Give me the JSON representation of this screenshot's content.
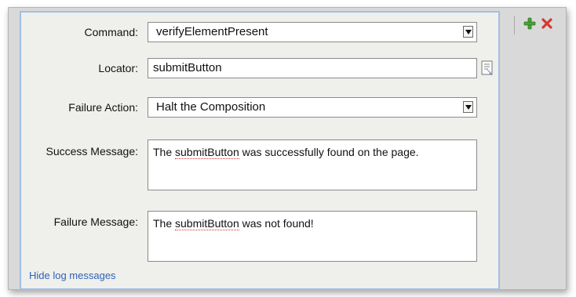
{
  "command": {
    "label": "Command:",
    "value": "verifyElementPresent"
  },
  "locator": {
    "label": "Locator:",
    "value": "submitButton"
  },
  "failure_action": {
    "label": "Failure Action:",
    "value": "Halt the Composition"
  },
  "success_message": {
    "label": "Success Message:",
    "prefix": "The ",
    "highlight": "submitButton",
    "suffix": " was successfully found on the page."
  },
  "failure_message": {
    "label": "Failure Message:",
    "prefix": "The ",
    "highlight": "submitButton",
    "suffix": " was not found!"
  },
  "hide_log_messages": "Hide log messages",
  "icons": {
    "add": "plus-icon",
    "remove": "x-icon",
    "picker": "locator-picker-icon",
    "dropdown": "chevron-down-icon"
  },
  "colors": {
    "panel_border": "#9fbfe6",
    "link": "#2f62b8",
    "add_green": "#4aa23a",
    "remove_red": "#d23a30"
  }
}
